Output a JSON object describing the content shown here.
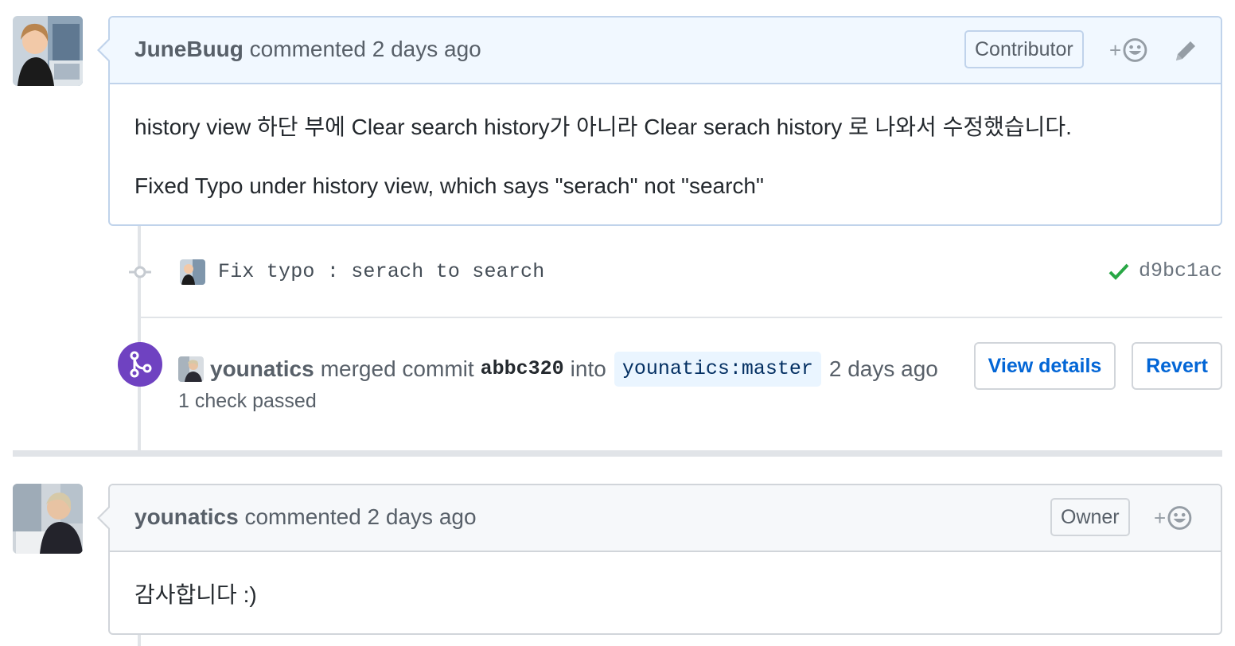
{
  "comment1": {
    "author": "JuneBuug",
    "meta": "commented 2 days ago",
    "role": "Contributor",
    "reaction_plus": "+",
    "body": [
      "history view 하단 부에 Clear search history가 아니라 Clear serach history 로 나와서 수정했습니다.",
      "Fixed Typo under history view, which says \"serach\" not \"search\""
    ]
  },
  "commit": {
    "message": "Fix typo : serach to search",
    "sha": "d9bc1ac",
    "status": "success"
  },
  "merge": {
    "author": "younatics",
    "text_merged": "merged commit",
    "sha": "abbc320",
    "text_into": "into",
    "branch": "younatics:master",
    "time": "2 days ago",
    "checks": "1 check passed",
    "view_details_label": "View details",
    "revert_label": "Revert"
  },
  "comment2": {
    "author": "younatics",
    "meta": "commented 2 days ago",
    "role": "Owner",
    "reaction_plus": "+",
    "body": [
      "감사합니다 :)"
    ]
  },
  "colors": {
    "merge_purple": "#6f42c1",
    "link_blue": "#0366d6",
    "success_green": "#28a745",
    "highlight_bg": "#f1f8ff"
  },
  "icons": [
    "smiley-icon",
    "pencil-icon",
    "git-commit-icon",
    "check-icon",
    "git-merge-icon"
  ]
}
